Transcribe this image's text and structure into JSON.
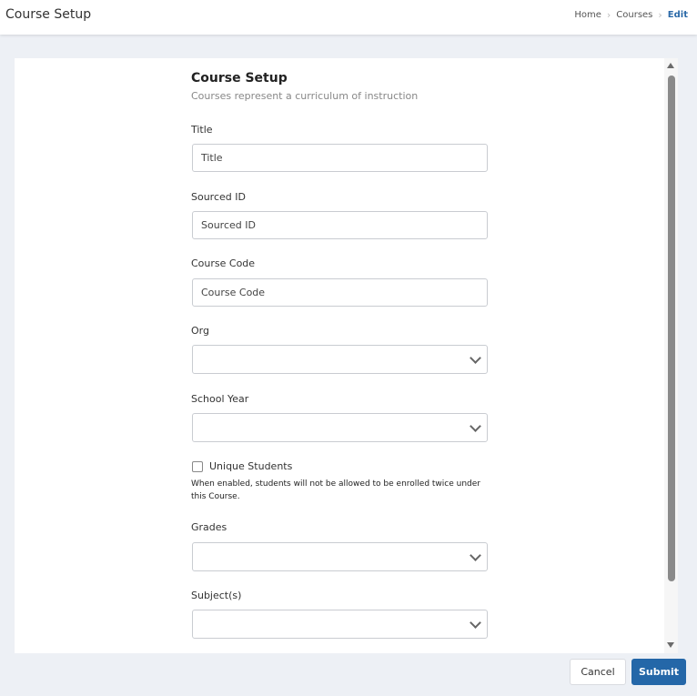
{
  "header": {
    "title": "Course Setup",
    "breadcrumb": [
      "Home",
      "Courses",
      "Edit"
    ]
  },
  "form": {
    "title": "Course Setup",
    "subtitle": "Courses represent a curriculum of instruction",
    "fields": {
      "title": {
        "label": "Title",
        "placeholder": "Title",
        "value": ""
      },
      "sourced_id": {
        "label": "Sourced ID",
        "placeholder": "Sourced ID",
        "value": ""
      },
      "course_code": {
        "label": "Course Code",
        "placeholder": "Course Code",
        "value": ""
      },
      "org": {
        "label": "Org",
        "value": ""
      },
      "school_year": {
        "label": "School Year",
        "value": ""
      },
      "unique_students": {
        "label": "Unique Students",
        "checked": false,
        "helper": "When enabled, students will not be allowed to be enrolled twice under this Course."
      },
      "grades": {
        "label": "Grades",
        "value": ""
      },
      "subjects": {
        "label": "Subject(s)",
        "value": ""
      }
    }
  },
  "footer": {
    "cancel_label": "Cancel",
    "submit_label": "Submit"
  },
  "colors": {
    "accent": "#2467a8",
    "page_background": "#edf0f5"
  }
}
